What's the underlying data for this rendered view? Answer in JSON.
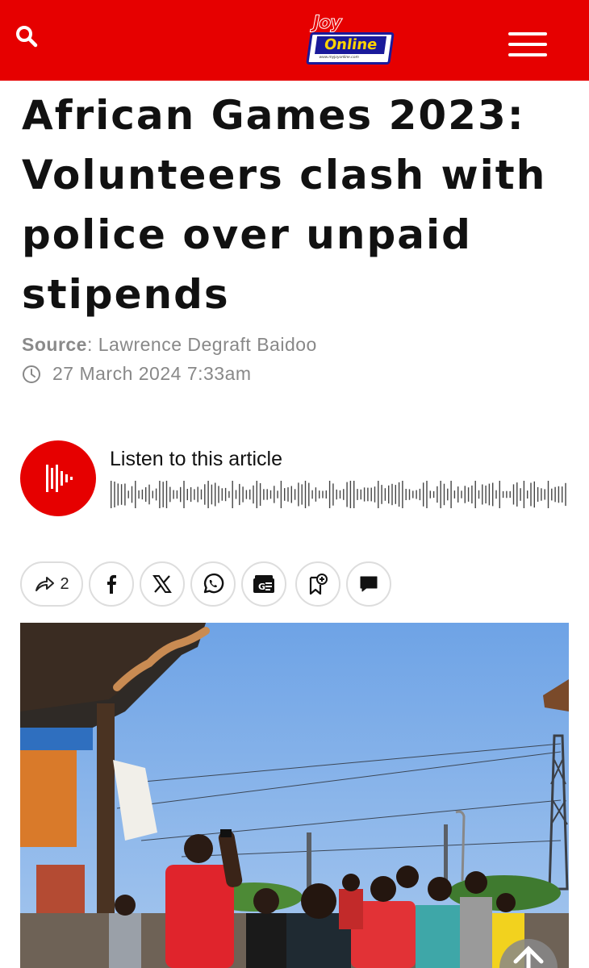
{
  "header": {
    "logo_top": "Joy",
    "logo_word": "Online",
    "logo_sub": "www.myjoyonline.com"
  },
  "article": {
    "title": "African Games 2023: Volunteers clash with police over unpaid stipends",
    "source_label": "Source",
    "source_separator": ":",
    "source_name": "Lawrence Degraft Baidoo",
    "date": "27 March 2024 7:33am"
  },
  "audio": {
    "label": "Listen to this article"
  },
  "share": {
    "count": "2"
  },
  "colors": {
    "brand_red": "#e60000",
    "logo_blue": "#1a1a9a",
    "logo_yellow": "#ffd400"
  },
  "icons": [
    "search-icon",
    "menu-icon",
    "clock-icon",
    "soundwave-icon",
    "share-icon",
    "facebook-icon",
    "x-icon",
    "whatsapp-icon",
    "google-news-icon",
    "bookmark-add-icon",
    "comment-icon",
    "scroll-up-icon"
  ]
}
